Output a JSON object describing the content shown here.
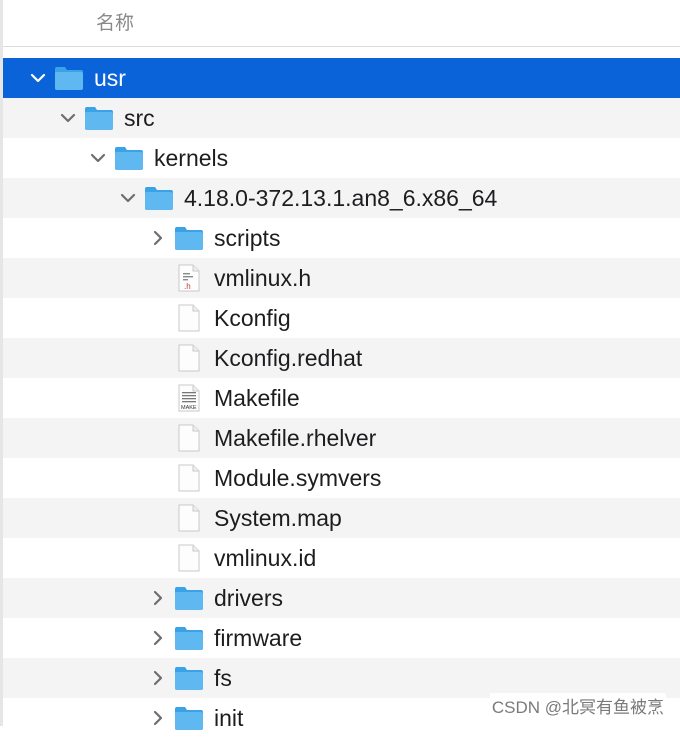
{
  "header": {
    "name_column": "名称"
  },
  "tree": [
    {
      "label": "usr",
      "type": "folder",
      "expanded": true,
      "selected": true
    },
    {
      "label": "src",
      "type": "folder",
      "expanded": true
    },
    {
      "label": "kernels",
      "type": "folder",
      "expanded": true
    },
    {
      "label": "4.18.0-372.13.1.an8_6.x86_64",
      "type": "folder",
      "expanded": true
    },
    {
      "label": "scripts",
      "type": "folder",
      "expanded": false
    },
    {
      "label": "vmlinux.h",
      "type": "file",
      "icon": "h-file-icon",
      "badge": ".h"
    },
    {
      "label": "Kconfig",
      "type": "file",
      "icon": "blank-file-icon"
    },
    {
      "label": "Kconfig.redhat",
      "type": "file",
      "icon": "blank-file-icon"
    },
    {
      "label": "Makefile",
      "type": "file",
      "icon": "makefile-icon",
      "badge": "MAKE"
    },
    {
      "label": "Makefile.rhelver",
      "type": "file",
      "icon": "blank-file-icon"
    },
    {
      "label": "Module.symvers",
      "type": "file",
      "icon": "blank-file-icon"
    },
    {
      "label": "System.map",
      "type": "file",
      "icon": "blank-file-icon"
    },
    {
      "label": "vmlinux.id",
      "type": "file",
      "icon": "blank-file-icon"
    },
    {
      "label": "drivers",
      "type": "folder",
      "expanded": false
    },
    {
      "label": "firmware",
      "type": "folder",
      "expanded": false
    },
    {
      "label": "fs",
      "type": "folder",
      "expanded": false
    },
    {
      "label": "init",
      "type": "folder",
      "expanded": false
    }
  ],
  "watermark": "CSDN @北冥有鱼被烹",
  "colors": {
    "selection": "#0a63d8",
    "folder": "#5fb8ef",
    "folder_tab": "#3aa2e6",
    "alt_row": "#f4f4f5"
  }
}
